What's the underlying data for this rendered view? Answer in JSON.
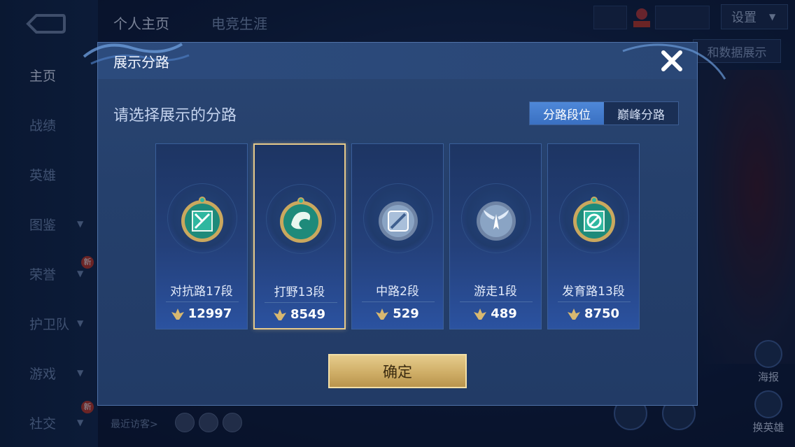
{
  "background": {
    "sidebar": [
      {
        "label": "主页",
        "active": true
      },
      {
        "label": "战绩"
      },
      {
        "label": "英雄"
      },
      {
        "label": "图鉴",
        "chevron": true
      },
      {
        "label": "荣誉",
        "chevron": true,
        "badge": "新"
      },
      {
        "label": "护卫队",
        "chevron": true
      },
      {
        "label": "游戏",
        "chevron": true
      },
      {
        "label": "社交",
        "chevron": true,
        "badge": "新"
      }
    ],
    "top_tabs": [
      "个人主页",
      "电竞生涯"
    ],
    "settings_label": "设置",
    "side_button_label": "和数据展示",
    "right_buttons": [
      "海报",
      "换英雄"
    ],
    "recent_visitors_label": "最近访客>"
  },
  "modal": {
    "title": "展示分路",
    "prompt": "请选择展示的分路",
    "tabs": [
      {
        "label": "分路段位",
        "active": true
      },
      {
        "label": "巅峰分路",
        "active": false
      }
    ],
    "cards": [
      {
        "rank": "对抗路17段",
        "score": "12997",
        "icon": "clash-lane-emblem-icon",
        "emblem_color": "#2fb7a0",
        "selected": false
      },
      {
        "rank": "打野13段",
        "score": "8549",
        "icon": "jungle-dragon-emblem-icon",
        "emblem_color": "#2fb7a0",
        "selected": true
      },
      {
        "rank": "中路2段",
        "score": "529",
        "icon": "mid-lane-emblem-icon",
        "emblem_color": "#8aa4c4",
        "selected": false
      },
      {
        "rank": "游走1段",
        "score": "489",
        "icon": "roam-wings-emblem-icon",
        "emblem_color": "#8aa4c4",
        "selected": false
      },
      {
        "rank": "发育路13段",
        "score": "8750",
        "icon": "farm-lane-emblem-icon",
        "emblem_color": "#2fb7a0",
        "selected": false
      }
    ],
    "confirm_label": "确定",
    "close_icon": "close-icon"
  },
  "colors": {
    "accent_gold": "#e5c98a",
    "tab_active": "#4e88d8",
    "modal_bg": "#25406c"
  }
}
